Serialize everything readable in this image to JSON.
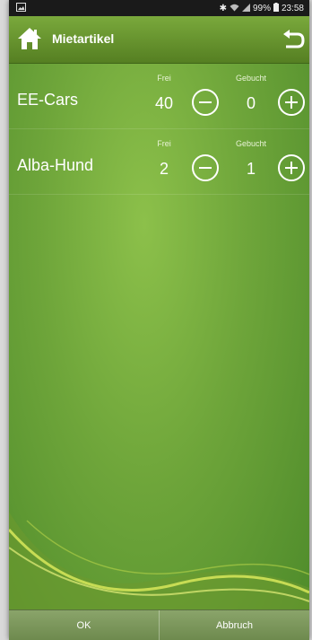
{
  "statusbar": {
    "battery": "99%",
    "time": "23:58"
  },
  "actionbar": {
    "title": "Mietartikel"
  },
  "items": [
    {
      "name": "EE-Cars",
      "frei_label": "Frei",
      "gebucht_label": "Gebucht",
      "frei": "40",
      "gebucht": "0"
    },
    {
      "name": "Alba-Hund",
      "frei_label": "Frei",
      "gebucht_label": "Gebucht",
      "frei": "2",
      "gebucht": "1"
    }
  ],
  "footer": {
    "ok_label": "OK",
    "cancel_label": "Abbruch"
  },
  "colors": {
    "accent": "#6ea53a",
    "bar": "#557f22"
  }
}
